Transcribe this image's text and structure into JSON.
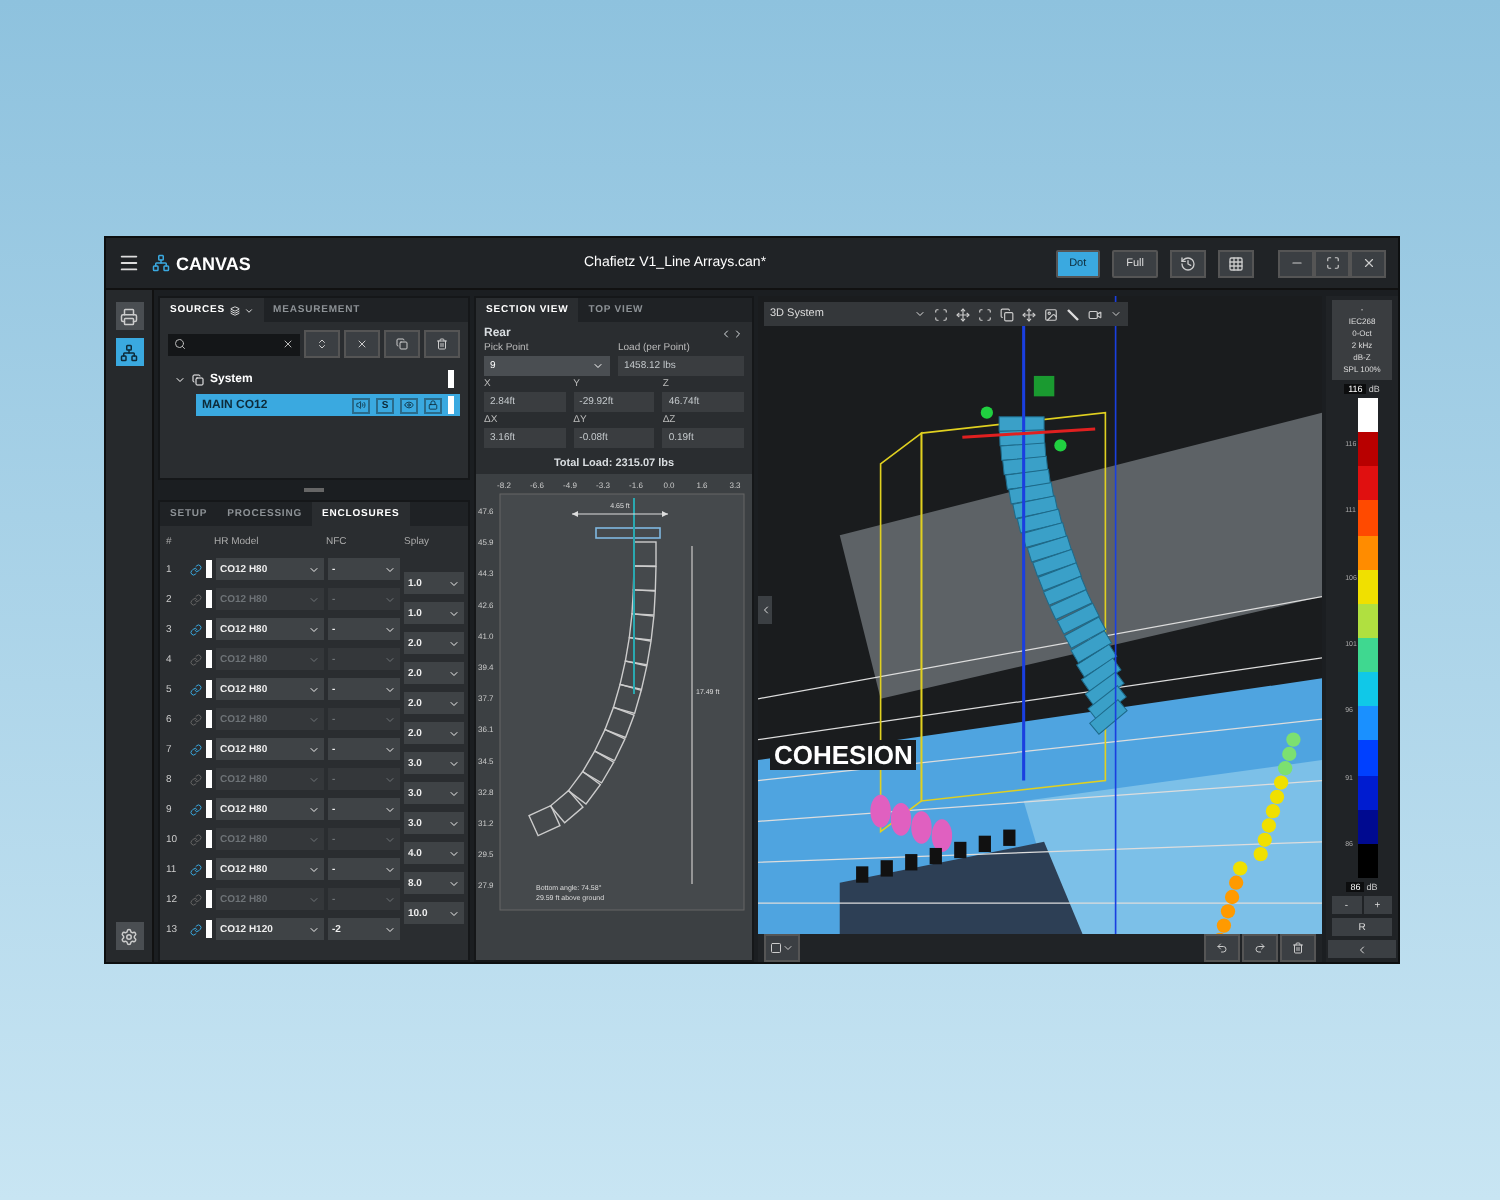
{
  "app": {
    "logo": "CANVAS",
    "title": "Chafietz V1_Line Arrays.can*",
    "view_modes": [
      {
        "label": "Dot",
        "selected": true
      },
      {
        "label": "Full",
        "selected": false
      }
    ]
  },
  "sources": {
    "tabs": [
      {
        "label": "SOURCES",
        "selected": true
      },
      {
        "label": "MEASUREMENT",
        "selected": false
      }
    ],
    "tree": [
      {
        "label": "System",
        "expanded": true,
        "children": [
          {
            "label": "MAIN CO12",
            "selected": true,
            "solo": "S"
          }
        ]
      }
    ]
  },
  "lower_tabs": [
    {
      "label": "SETUP",
      "selected": false
    },
    {
      "label": "PROCESSING",
      "selected": false
    },
    {
      "label": "ENCLOSURES",
      "selected": true
    }
  ],
  "enclosures": {
    "columns": [
      "#",
      "HR Model",
      "NFC",
      "Splay"
    ],
    "rows": [
      {
        "number": "1",
        "model": "CO12 H80",
        "nfc": "-",
        "disabled": false
      },
      {
        "number": "2",
        "model": "CO12 H80",
        "nfc": "-",
        "disabled": true
      },
      {
        "number": "3",
        "model": "CO12 H80",
        "nfc": "-",
        "disabled": false
      },
      {
        "number": "4",
        "model": "CO12 H80",
        "nfc": "-",
        "disabled": true
      },
      {
        "number": "5",
        "model": "CO12 H80",
        "nfc": "-",
        "disabled": false
      },
      {
        "number": "6",
        "model": "CO12 H80",
        "nfc": "-",
        "disabled": true
      },
      {
        "number": "7",
        "model": "CO12 H80",
        "nfc": "-",
        "disabled": false
      },
      {
        "number": "8",
        "model": "CO12 H80",
        "nfc": "-",
        "disabled": true
      },
      {
        "number": "9",
        "model": "CO12 H80",
        "nfc": "-",
        "disabled": false
      },
      {
        "number": "10",
        "model": "CO12 H80",
        "nfc": "-",
        "disabled": true
      },
      {
        "number": "11",
        "model": "CO12 H80",
        "nfc": "-",
        "disabled": false
      },
      {
        "number": "12",
        "model": "CO12 H80",
        "nfc": "-",
        "disabled": true
      },
      {
        "number": "13",
        "model": "CO12 H120",
        "nfc": "-2",
        "disabled": false
      }
    ],
    "splay": [
      "1.0",
      "1.0",
      "2.0",
      "2.0",
      "2.0",
      "2.0",
      "3.0",
      "3.0",
      "3.0",
      "4.0",
      "8.0",
      "10.0"
    ]
  },
  "section": {
    "tabs": [
      {
        "label": "SECTION VIEW",
        "selected": true
      },
      {
        "label": "TOP VIEW",
        "selected": false
      }
    ],
    "heading": "Rear",
    "pick_point": {
      "label": "Pick Point",
      "value": "9"
    },
    "load": {
      "label": "Load (per Point)",
      "value": "1458.12 lbs"
    },
    "coords": [
      {
        "label": "X",
        "value": "2.84ft"
      },
      {
        "label": "Y",
        "value": "-29.92ft"
      },
      {
        "label": "Z",
        "value": "46.74ft"
      },
      {
        "label": "ΔX",
        "value": "3.16ft"
      },
      {
        "label": "ΔY",
        "value": "-0.08ft"
      },
      {
        "label": "ΔZ",
        "value": "0.19ft"
      }
    ],
    "total_load": {
      "label": "Total Load:",
      "value": "2315.07 lbs"
    },
    "x_ticks": [
      "-8.2",
      "-6.6",
      "-4.9",
      "-3.3",
      "-1.6",
      "0.0",
      "1.6",
      "3.3"
    ],
    "y_ticks": [
      "47.6",
      "45.9",
      "44.3",
      "42.6",
      "41.0",
      "39.4",
      "37.7",
      "36.1",
      "34.5",
      "32.8",
      "31.2",
      "29.5",
      "27.9"
    ],
    "width_label": "4.65 ft",
    "height_label": "17.49 ft",
    "bottom_note": [
      "Bottom angle: 74.58°",
      "29.59 ft above ground"
    ]
  },
  "viewport": {
    "view": "3D System",
    "scene_text": "COHESION"
  },
  "legend": {
    "info": [
      "-",
      "IEC268",
      "0-Oct",
      "2 kHz",
      "dB-Z",
      "SPL 100%"
    ],
    "max": {
      "value": "116",
      "unit": "dB"
    },
    "min": {
      "value": "86",
      "unit": "dB"
    },
    "ticks": [
      "116",
      "111",
      "106",
      "101",
      "96",
      "91",
      "86"
    ],
    "buttons": [
      "-",
      "+",
      "R"
    ]
  }
}
